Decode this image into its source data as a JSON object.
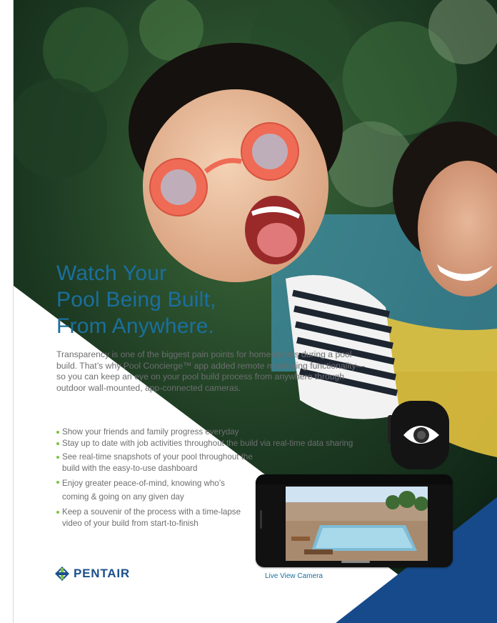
{
  "headline": {
    "line1": "Watch Your",
    "line2": "Pool Being Built,",
    "line3": "From Anywhere."
  },
  "intro": "Transparency is one of the biggest pain points for homeowners during a pool build. That’s why Pool Concierge™ app added remote monitoring functionality—so you can keep an eye on your pool build process from anywhere through outdoor wall-mounted, app-connected cameras.",
  "bullets": [
    "Show your friends and family progress everyday",
    "Stay up to date with job activities throughout the build via real-time data sharing",
    "See real-time snapshots of your pool throughout the build with the easy-to-use dashboard",
    "Enjoy greater peace-of-mind, knowing who’s coming & going on any given day",
    "Keep a souvenir of the process with a time-lapse video of your build from start-to-finish"
  ],
  "brand": {
    "name": "PENTAIR",
    "color": "#1b4f8a",
    "accent": "#7cc242"
  },
  "caption": "Live View Camera",
  "colors": {
    "headline": "#1b6f9e",
    "body": "#6d6e70",
    "navy_triangle": "#174a8a"
  }
}
